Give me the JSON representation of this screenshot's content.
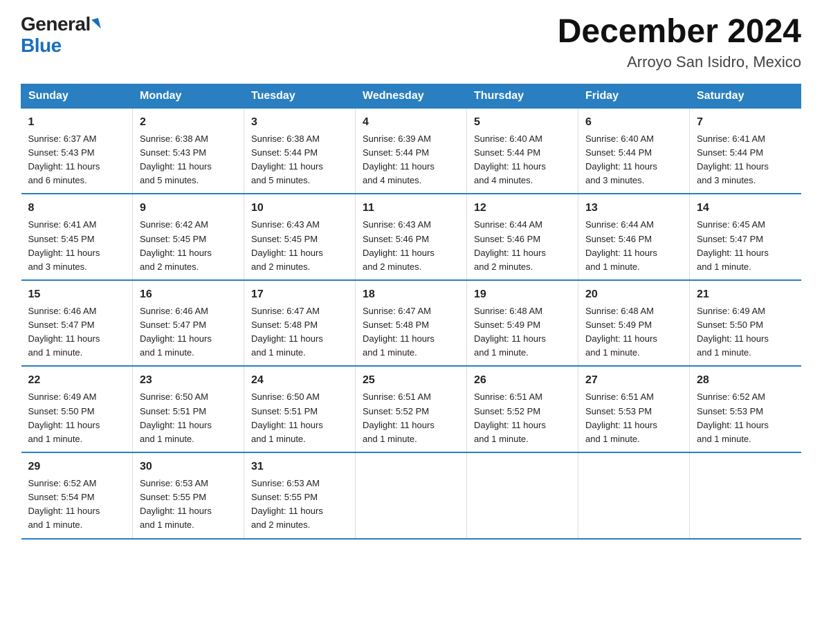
{
  "logo": {
    "general": "General",
    "blue": "Blue"
  },
  "header": {
    "month": "December 2024",
    "location": "Arroyo San Isidro, Mexico"
  },
  "weekdays": [
    "Sunday",
    "Monday",
    "Tuesday",
    "Wednesday",
    "Thursday",
    "Friday",
    "Saturday"
  ],
  "weeks": [
    [
      {
        "day": "1",
        "sunrise": "6:37 AM",
        "sunset": "5:43 PM",
        "daylight": "11 hours and 6 minutes."
      },
      {
        "day": "2",
        "sunrise": "6:38 AM",
        "sunset": "5:43 PM",
        "daylight": "11 hours and 5 minutes."
      },
      {
        "day": "3",
        "sunrise": "6:38 AM",
        "sunset": "5:44 PM",
        "daylight": "11 hours and 5 minutes."
      },
      {
        "day": "4",
        "sunrise": "6:39 AM",
        "sunset": "5:44 PM",
        "daylight": "11 hours and 4 minutes."
      },
      {
        "day": "5",
        "sunrise": "6:40 AM",
        "sunset": "5:44 PM",
        "daylight": "11 hours and 4 minutes."
      },
      {
        "day": "6",
        "sunrise": "6:40 AM",
        "sunset": "5:44 PM",
        "daylight": "11 hours and 3 minutes."
      },
      {
        "day": "7",
        "sunrise": "6:41 AM",
        "sunset": "5:44 PM",
        "daylight": "11 hours and 3 minutes."
      }
    ],
    [
      {
        "day": "8",
        "sunrise": "6:41 AM",
        "sunset": "5:45 PM",
        "daylight": "11 hours and 3 minutes."
      },
      {
        "day": "9",
        "sunrise": "6:42 AM",
        "sunset": "5:45 PM",
        "daylight": "11 hours and 2 minutes."
      },
      {
        "day": "10",
        "sunrise": "6:43 AM",
        "sunset": "5:45 PM",
        "daylight": "11 hours and 2 minutes."
      },
      {
        "day": "11",
        "sunrise": "6:43 AM",
        "sunset": "5:46 PM",
        "daylight": "11 hours and 2 minutes."
      },
      {
        "day": "12",
        "sunrise": "6:44 AM",
        "sunset": "5:46 PM",
        "daylight": "11 hours and 2 minutes."
      },
      {
        "day": "13",
        "sunrise": "6:44 AM",
        "sunset": "5:46 PM",
        "daylight": "11 hours and 1 minute."
      },
      {
        "day": "14",
        "sunrise": "6:45 AM",
        "sunset": "5:47 PM",
        "daylight": "11 hours and 1 minute."
      }
    ],
    [
      {
        "day": "15",
        "sunrise": "6:46 AM",
        "sunset": "5:47 PM",
        "daylight": "11 hours and 1 minute."
      },
      {
        "day": "16",
        "sunrise": "6:46 AM",
        "sunset": "5:47 PM",
        "daylight": "11 hours and 1 minute."
      },
      {
        "day": "17",
        "sunrise": "6:47 AM",
        "sunset": "5:48 PM",
        "daylight": "11 hours and 1 minute."
      },
      {
        "day": "18",
        "sunrise": "6:47 AM",
        "sunset": "5:48 PM",
        "daylight": "11 hours and 1 minute."
      },
      {
        "day": "19",
        "sunrise": "6:48 AM",
        "sunset": "5:49 PM",
        "daylight": "11 hours and 1 minute."
      },
      {
        "day": "20",
        "sunrise": "6:48 AM",
        "sunset": "5:49 PM",
        "daylight": "11 hours and 1 minute."
      },
      {
        "day": "21",
        "sunrise": "6:49 AM",
        "sunset": "5:50 PM",
        "daylight": "11 hours and 1 minute."
      }
    ],
    [
      {
        "day": "22",
        "sunrise": "6:49 AM",
        "sunset": "5:50 PM",
        "daylight": "11 hours and 1 minute."
      },
      {
        "day": "23",
        "sunrise": "6:50 AM",
        "sunset": "5:51 PM",
        "daylight": "11 hours and 1 minute."
      },
      {
        "day": "24",
        "sunrise": "6:50 AM",
        "sunset": "5:51 PM",
        "daylight": "11 hours and 1 minute."
      },
      {
        "day": "25",
        "sunrise": "6:51 AM",
        "sunset": "5:52 PM",
        "daylight": "11 hours and 1 minute."
      },
      {
        "day": "26",
        "sunrise": "6:51 AM",
        "sunset": "5:52 PM",
        "daylight": "11 hours and 1 minute."
      },
      {
        "day": "27",
        "sunrise": "6:51 AM",
        "sunset": "5:53 PM",
        "daylight": "11 hours and 1 minute."
      },
      {
        "day": "28",
        "sunrise": "6:52 AM",
        "sunset": "5:53 PM",
        "daylight": "11 hours and 1 minute."
      }
    ],
    [
      {
        "day": "29",
        "sunrise": "6:52 AM",
        "sunset": "5:54 PM",
        "daylight": "11 hours and 1 minute."
      },
      {
        "day": "30",
        "sunrise": "6:53 AM",
        "sunset": "5:55 PM",
        "daylight": "11 hours and 1 minute."
      },
      {
        "day": "31",
        "sunrise": "6:53 AM",
        "sunset": "5:55 PM",
        "daylight": "11 hours and 2 minutes."
      },
      null,
      null,
      null,
      null
    ]
  ],
  "labels": {
    "sunrise": "Sunrise:",
    "sunset": "Sunset:",
    "daylight": "Daylight:"
  }
}
